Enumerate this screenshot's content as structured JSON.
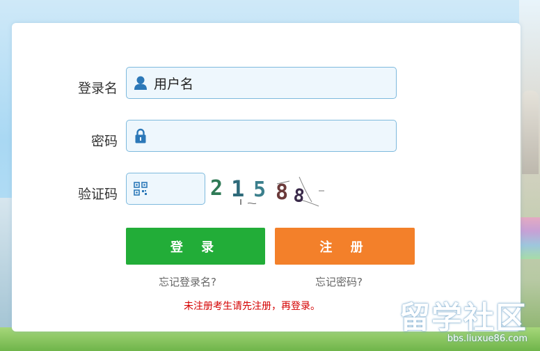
{
  "form": {
    "username_label": "登录名",
    "username_value": "用户名",
    "password_label": "密码",
    "password_value": "",
    "captcha_label": "验证码",
    "captcha_value": "",
    "captcha_image_text": "21588"
  },
  "buttons": {
    "login": "登 录",
    "register": "注 册"
  },
  "links": {
    "forgot_username": "忘记登录名?",
    "forgot_password": "忘记密码?"
  },
  "notice": "未注册考生请先注册，再登录。",
  "watermark": {
    "title": "留学社区",
    "url": "bbs.liuxue86.com"
  },
  "colors": {
    "login_button": "#22ad38",
    "register_button": "#f3802a",
    "notice_text": "#d40000",
    "input_border": "#7db9dd",
    "icon_blue": "#2c78b8"
  },
  "icons": [
    "user-icon",
    "lock-icon",
    "qr-icon"
  ]
}
